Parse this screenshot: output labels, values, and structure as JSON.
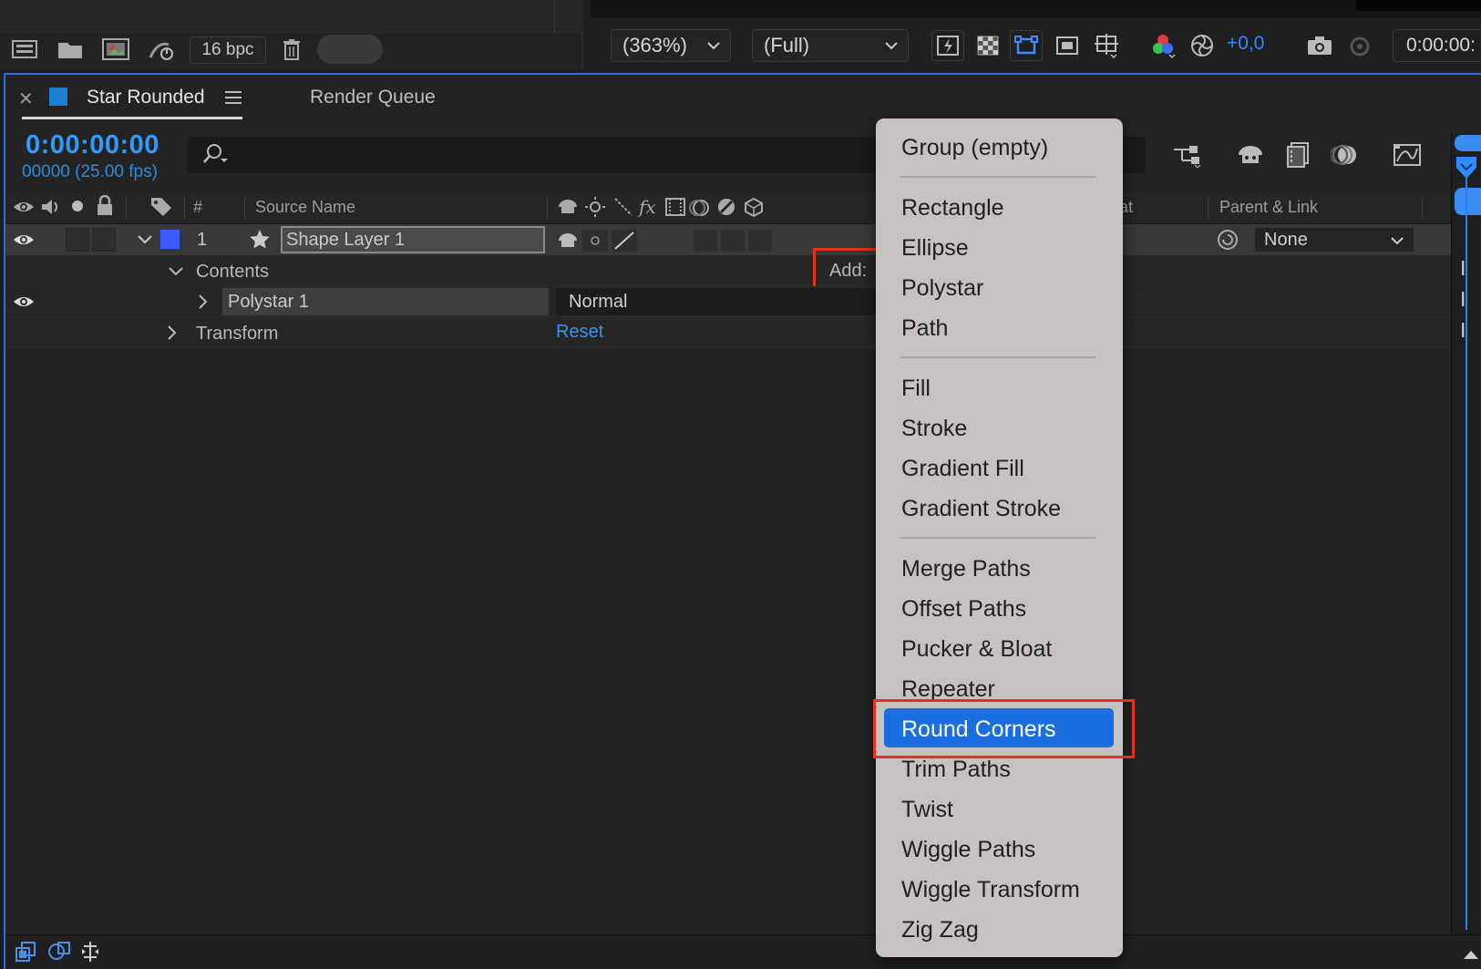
{
  "toolbar": {
    "bit_depth": "16 bpc",
    "zoom": "(363%)",
    "resolution": "(Full)",
    "exposure": "+0,0",
    "current_time": "0:00:00:"
  },
  "tabs": [
    {
      "label": "Star Rounded",
      "active": true,
      "swatch_color": "#1e7fd0"
    },
    {
      "label": "Render Queue",
      "active": false
    }
  ],
  "timeline": {
    "timecode": "0:00:00:00",
    "frames_fps": "00000 (25.00 fps)",
    "columns": {
      "number": "#",
      "source_name": "Source Name",
      "mode_partial": "at",
      "parent_link": "Parent & Link"
    },
    "layer": {
      "index": "1",
      "name": "Shape Layer 1",
      "label_color": "#3d5cff",
      "parent": "None"
    },
    "contents": {
      "label": "Contents",
      "add_label": "Add:"
    },
    "polystar": {
      "name": "Polystar 1",
      "blend_mode": "Normal"
    },
    "transform": {
      "label": "Transform",
      "reset_label": "Reset"
    }
  },
  "menu": {
    "groups": [
      [
        "Group (empty)"
      ],
      [
        "Rectangle",
        "Ellipse",
        "Polystar",
        "Path"
      ],
      [
        "Fill",
        "Stroke",
        "Gradient Fill",
        "Gradient Stroke"
      ],
      [
        "Merge Paths",
        "Offset Paths",
        "Pucker & Bloat",
        "Repeater",
        "Round Corners",
        "Trim Paths",
        "Twist",
        "Wiggle Paths",
        "Wiggle Transform",
        "Zig Zag"
      ]
    ],
    "selected": "Round Corners"
  },
  "colors": {
    "accent": "#2f9bff",
    "highlight_box": "#e5301c",
    "menu_selected": "#1a6ee0"
  }
}
